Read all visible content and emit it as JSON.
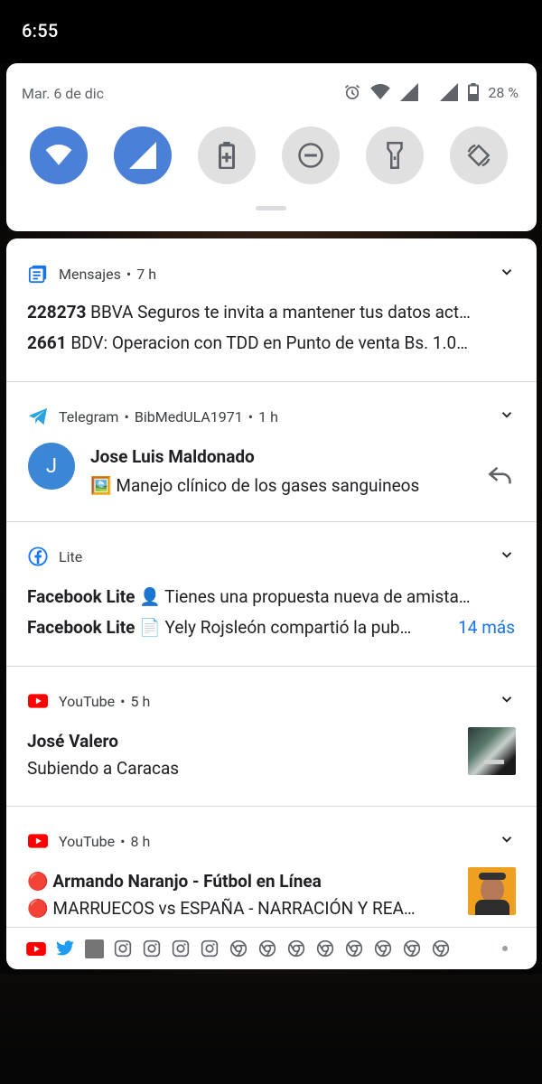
{
  "status_bar": {
    "time": "6:55"
  },
  "quick_settings": {
    "date": "Mar. 6 de dic",
    "battery": "28 %",
    "tiles": [
      {
        "name": "wifi",
        "on": true
      },
      {
        "name": "mobile-data",
        "on": true
      },
      {
        "name": "battery-saver",
        "on": false
      },
      {
        "name": "do-not-disturb",
        "on": false
      },
      {
        "name": "flashlight",
        "on": false
      },
      {
        "name": "auto-rotate",
        "on": false
      }
    ]
  },
  "notifications": [
    {
      "app": "Mensajes",
      "dot": "•",
      "time": "7 h",
      "lines": [
        {
          "sender": "228273",
          "text": "BBVA Seguros te invita a mantener tus datos act…"
        },
        {
          "sender": "2661",
          "text": "BDV: Operacion con TDD en Punto de venta Bs.  1.0…"
        }
      ]
    },
    {
      "app": "Telegram",
      "dot": "•",
      "subtext": "BibMedULA1971",
      "dot2": "•",
      "time": "1 h",
      "avatar_letter": "J",
      "title": "Jose Luis Maldonado",
      "text": "🖼️ Manejo clínico de los gases sanguineos"
    },
    {
      "app": "Lite",
      "lines": [
        {
          "sender": "Facebook Lite",
          "text": "👤 Tienes una propuesta nueva de amista…"
        },
        {
          "sender": "Facebook Lite",
          "text": "📄 Yely Rojsleón compartió la pub…"
        }
      ],
      "more": "14 más"
    },
    {
      "app": "YouTube",
      "dot": "•",
      "time": "5 h",
      "title": "José Valero",
      "text": "Subiendo a Caracas"
    },
    {
      "app": "YouTube",
      "dot": "•",
      "time": "8 h",
      "title": "🔴 Armando Naranjo - Fútbol en Línea",
      "text": "🔴 MARRUECOS vs ESPAÑA - NARRACIÓN Y REA…"
    }
  ],
  "overflow_icons": [
    "youtube-icon",
    "twitter-icon",
    "app-icon",
    "instagram-icon",
    "instagram-icon",
    "instagram-icon",
    "instagram-icon",
    "chrome-icon",
    "chrome-icon",
    "chrome-icon",
    "chrome-icon",
    "chrome-icon",
    "chrome-icon",
    "chrome-icon",
    "chrome-icon"
  ],
  "colors": {
    "accent": "#4a80d8",
    "link": "#1a73e8",
    "youtube": "#ff0000",
    "telegram": "#2aa3e0",
    "messages": "#1a73e8"
  }
}
